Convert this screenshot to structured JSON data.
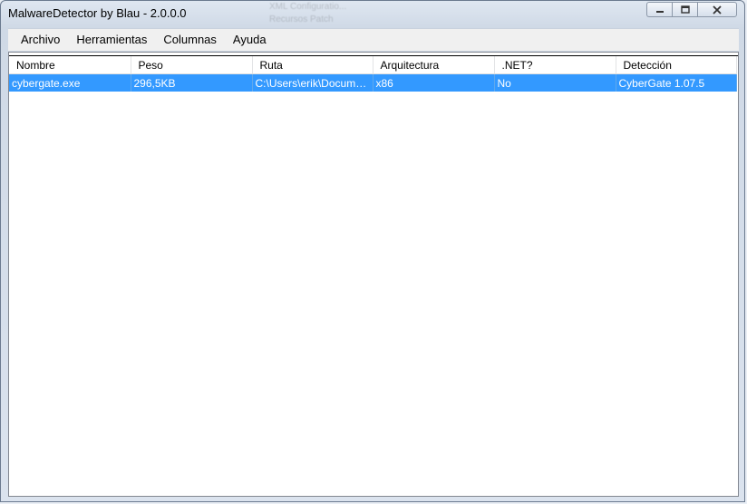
{
  "window": {
    "title": "MalwareDetector by Blau - 2.0.0.0"
  },
  "background_ghost": [
    "XML Configuratio...",
    "Recursos Patch"
  ],
  "caption_buttons": [
    "minimize-icon",
    "maximize-icon",
    "close-icon"
  ],
  "menu": [
    "Archivo",
    "Herramientas",
    "Columnas",
    "Ayuda"
  ],
  "table": {
    "columns": [
      "Nombre",
      "Peso",
      "Ruta",
      "Arquitectura",
      ".NET?",
      "Detección"
    ],
    "rows": [
      [
        "cybergate.exe",
        "296,5KB",
        "C:\\Users\\erik\\Documen...",
        "x86",
        "No",
        "CyberGate 1.07.5"
      ]
    ],
    "selected_row": 0,
    "selection_color": "#3399ff"
  }
}
